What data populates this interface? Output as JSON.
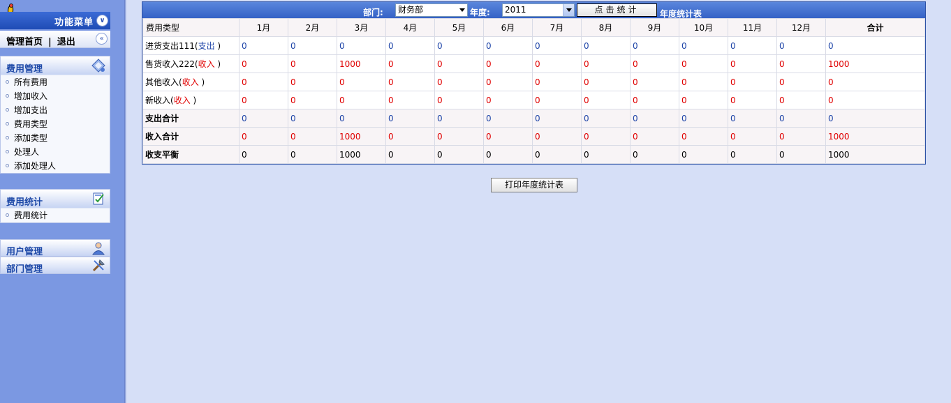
{
  "sidebar": {
    "menu_title": "功能菜单",
    "collapse_icon": "chevron-double-down-icon",
    "home_link": "管理首页",
    "separator": "|",
    "logout_link": "退出",
    "fee_panel": {
      "title": "费用管理",
      "items": [
        "所有费用",
        "增加收入",
        "增加支出",
        "费用类型",
        "添加类型",
        "处理人",
        "添加处理人"
      ]
    },
    "stat_panel": {
      "title": "费用统计",
      "items": [
        "费用统计"
      ]
    },
    "user_panel": {
      "title": "用户管理"
    },
    "dept_panel": {
      "title": "部门管理"
    }
  },
  "toolbar": {
    "dept_label": "部门:",
    "dept_value": "财务部",
    "year_label": "年度:",
    "year_value": "2011",
    "stat_button": "点击统计",
    "report_title": "年度统计表"
  },
  "table": {
    "header": [
      "费用类型",
      "1月",
      "2月",
      "3月",
      "4月",
      "5月",
      "6月",
      "7月",
      "8月",
      "9月",
      "10月",
      "11月",
      "12月",
      "合计"
    ],
    "rows": [
      {
        "name": "进货支出111",
        "tag": "支出",
        "values": [
          "0",
          "0",
          "0",
          "0",
          "0",
          "0",
          "0",
          "0",
          "0",
          "0",
          "0",
          "0",
          "0"
        ]
      },
      {
        "name": "售货收入222",
        "tag": "收入",
        "values": [
          "0",
          "0",
          "1000",
          "0",
          "0",
          "0",
          "0",
          "0",
          "0",
          "0",
          "0",
          "0",
          "1000"
        ]
      },
      {
        "name": "其他收入",
        "tag": "收入",
        "values": [
          "0",
          "0",
          "0",
          "0",
          "0",
          "0",
          "0",
          "0",
          "0",
          "0",
          "0",
          "0",
          "0"
        ]
      },
      {
        "name": "新收入",
        "tag": "收入",
        "values": [
          "0",
          "0",
          "0",
          "0",
          "0",
          "0",
          "0",
          "0",
          "0",
          "0",
          "0",
          "0",
          "0"
        ]
      }
    ],
    "totals": [
      {
        "name": "支出合计",
        "values": [
          "0",
          "0",
          "0",
          "0",
          "0",
          "0",
          "0",
          "0",
          "0",
          "0",
          "0",
          "0",
          "0"
        ]
      },
      {
        "name": "收入合计",
        "values": [
          "0",
          "0",
          "1000",
          "0",
          "0",
          "0",
          "0",
          "0",
          "0",
          "0",
          "0",
          "0",
          "1000"
        ]
      },
      {
        "name": "收支平衡",
        "values": [
          "0",
          "0",
          "1000",
          "0",
          "0",
          "0",
          "0",
          "0",
          "0",
          "0",
          "0",
          "0",
          "1000"
        ]
      }
    ]
  },
  "print_button": "打印年度统计表",
  "colors": {
    "expense": "#1f45a8",
    "income": "#e00000",
    "balance": "#000000"
  }
}
